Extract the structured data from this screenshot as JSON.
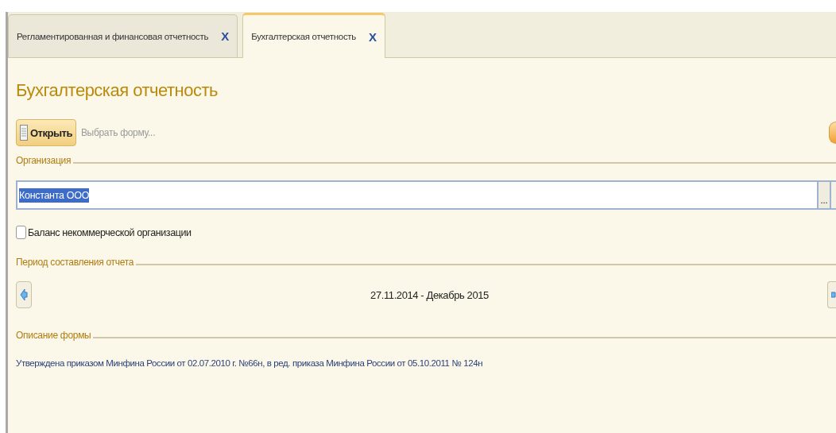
{
  "tabs": [
    {
      "label": "Регламентированная и финансовая отчетность",
      "close": "X",
      "selected": false
    },
    {
      "label": "Бухгалтерская отчетность",
      "close": "X",
      "selected": true
    }
  ],
  "title": "Бухгалтерская отчетность",
  "toolbar": {
    "open_button": "Открыть",
    "select_form_link": "Выбрать форму..."
  },
  "organization": {
    "label": "Организация",
    "value": "Константа ООО",
    "choice_button": "..."
  },
  "nonprofit_balance": {
    "label": "Баланс некоммерческой организации",
    "checked": false
  },
  "period": {
    "label": "Период составления отчета",
    "value": "27.11.2014 - Декабрь 2015"
  },
  "description": {
    "label": "Описание формы",
    "text": "Утверждена приказом Минфина России от 02.07.2010 г. №66н, в ред. приказа Минфина России от 05.10.2011 № 124н"
  }
}
